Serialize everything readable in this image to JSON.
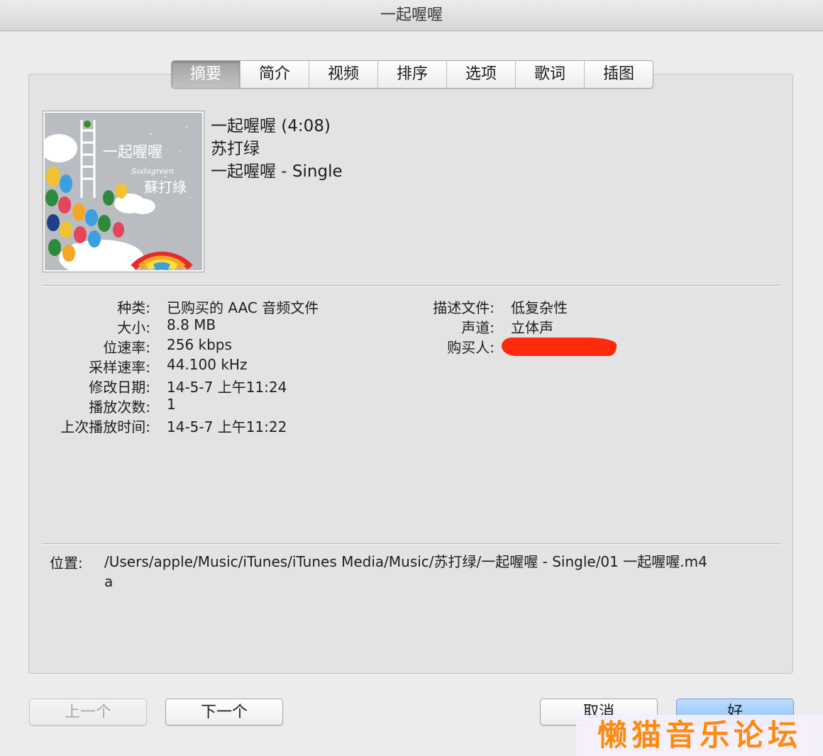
{
  "window": {
    "title": "一起喔喔"
  },
  "tabs": [
    {
      "label": "摘要",
      "active": true
    },
    {
      "label": "简介"
    },
    {
      "label": "视频"
    },
    {
      "label": "排序"
    },
    {
      "label": "选项"
    },
    {
      "label": "歌词"
    },
    {
      "label": "插图"
    }
  ],
  "song": {
    "title_line": "一起喔喔 (4:08)",
    "artist": "苏打绿",
    "album": "一起喔喔 - Single"
  },
  "artwork": {
    "text_main": "一起喔喔",
    "text_artist": "蘇打綠",
    "text_en": "Sodagreen"
  },
  "details_left": [
    {
      "label": "种类:",
      "value": "已购买的 AAC 音频文件"
    },
    {
      "label": "大小:",
      "value": "8.8 MB"
    },
    {
      "label": "位速率:",
      "value": "256 kbps"
    },
    {
      "label": "采样速率:",
      "value": "44.100 kHz"
    },
    {
      "label": "修改日期:",
      "value": "14-5-7 上午11:24"
    },
    {
      "label": "播放次数:",
      "value": "1"
    },
    {
      "label": "上次播放时间:",
      "value": "14-5-7 上午11:22"
    }
  ],
  "details_right": [
    {
      "label": "描述文件:",
      "value": "低复杂性"
    },
    {
      "label": "声道:",
      "value": "立体声"
    },
    {
      "label": "购买人:",
      "value": ""
    }
  ],
  "location": {
    "label": "位置:",
    "path": "/Users/apple/Music/iTunes/iTunes Media/Music/苏打绿/一起喔喔 - Single/01 一起喔喔.m4a"
  },
  "buttons": {
    "prev": "上一个",
    "next": "下一个",
    "cancel": "取消",
    "ok": "好"
  },
  "watermark": "懒猫音乐论坛",
  "colors": {
    "redaction": "#ff2a0e",
    "watermark": "#ff8a12",
    "ok_button": "#8ec1f4"
  }
}
